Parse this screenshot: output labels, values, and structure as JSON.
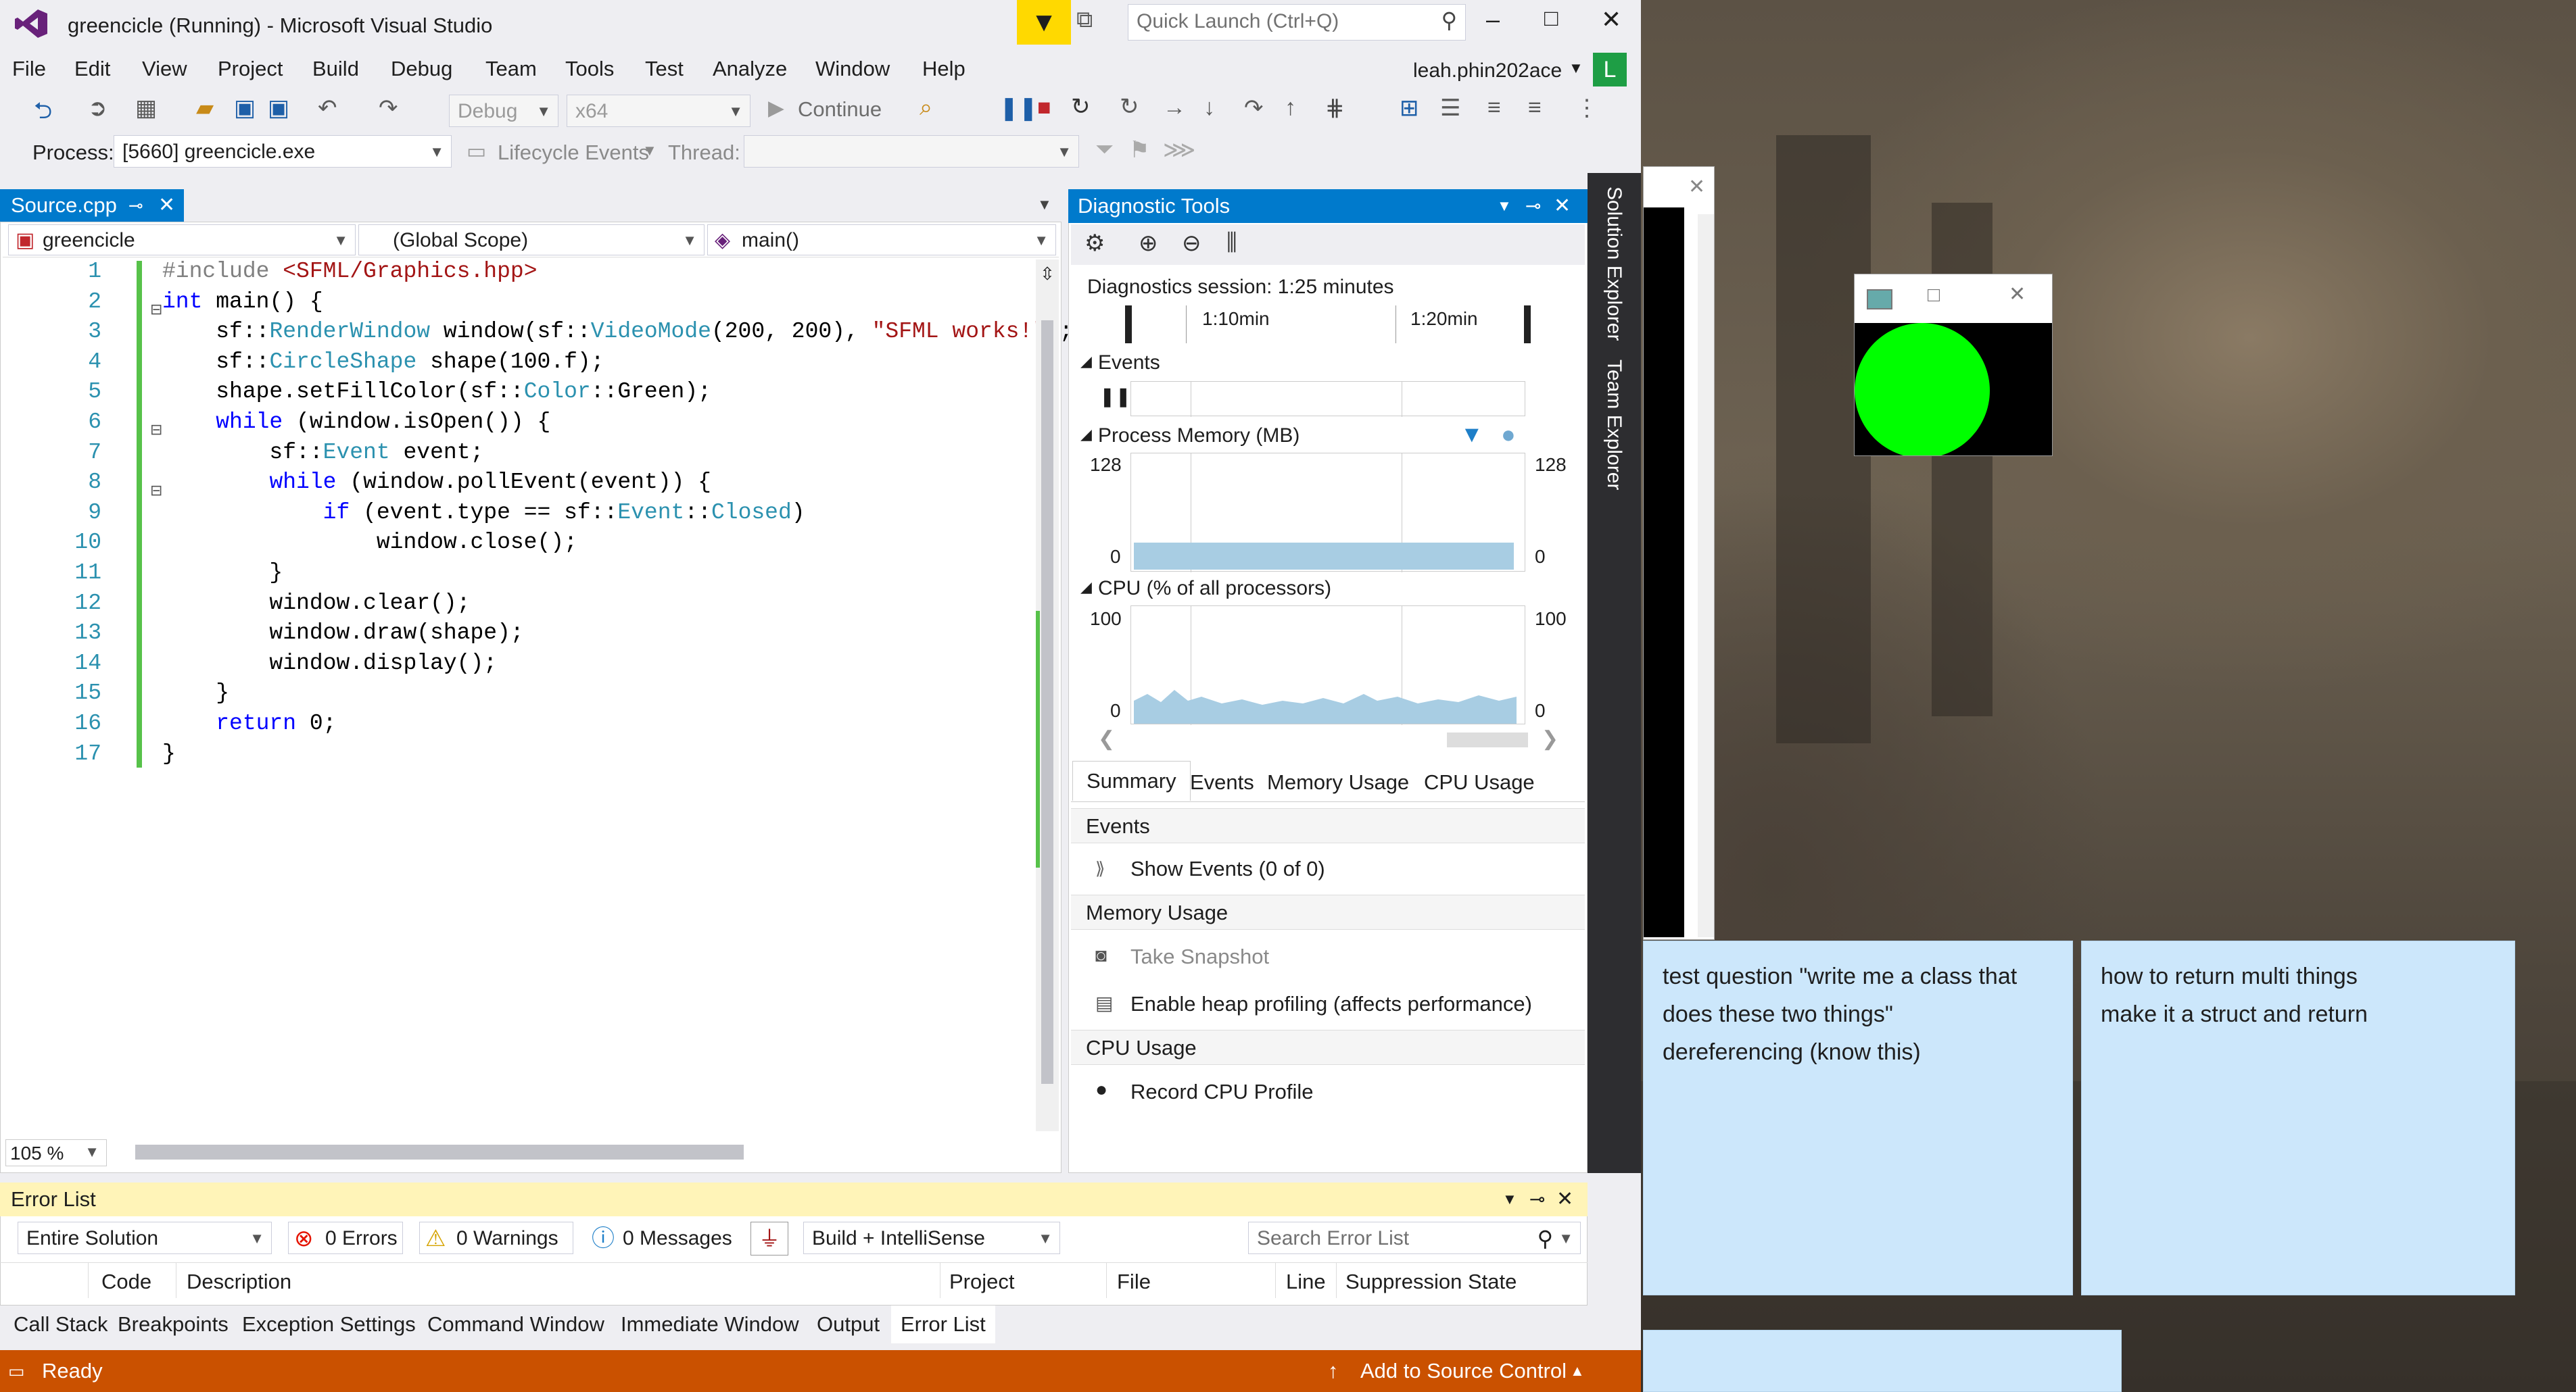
{
  "window": {
    "title": "greencicle (Running) - Microsoft Visual Studio",
    "quick_launch_placeholder": "Quick Launch (Ctrl+Q)",
    "user": "leah.phin202ace",
    "user_initial": "L"
  },
  "menu": [
    "File",
    "Edit",
    "View",
    "Project",
    "Build",
    "Debug",
    "Team",
    "Tools",
    "Test",
    "Analyze",
    "Window",
    "Help"
  ],
  "toolbar": {
    "config": "Debug",
    "platform": "x64",
    "continue_label": "Continue",
    "process_label": "Process:",
    "process_value": "[5660] greencicle.exe",
    "lifecycle_label": "Lifecycle Events",
    "thread_label": "Thread:"
  },
  "editor": {
    "tab": "Source.cpp",
    "project_combo": "greencicle",
    "scope_combo": "(Global Scope)",
    "member_combo": "main()",
    "zoom": "105 %",
    "line_numbers": "1\n2\n3\n4\n5\n6\n7\n8\n9\n10\n11\n12\n13\n14\n15\n16\n17"
  },
  "diagnostics": {
    "title": "Diagnostic Tools",
    "session": "Diagnostics session: 1:25 minutes",
    "tick1": "1:10min",
    "tick2": "1:20min",
    "events_label": "Events",
    "memory_label": "Process Memory (MB)",
    "mem_max": "128",
    "mem_min": "0",
    "cpu_label": "CPU (% of all processors)",
    "cpu_max": "100",
    "cpu_min": "0",
    "tabs": [
      "Summary",
      "Events",
      "Memory Usage",
      "CPU Usage"
    ],
    "sec_events": "Events",
    "show_events": "Show Events (0 of 0)",
    "sec_memory": "Memory Usage",
    "take_snapshot": "Take Snapshot",
    "heap_profiling": "Enable heap profiling (affects performance)",
    "sec_cpu": "CPU Usage",
    "record_cpu": "Record CPU Profile"
  },
  "side_rail": {
    "solution_explorer": "Solution Explorer",
    "team_explorer": "Team Explorer"
  },
  "error_list": {
    "title": "Error List",
    "scope": "Entire Solution",
    "errors": "0 Errors",
    "warnings": "0 Warnings",
    "messages": "0 Messages",
    "build_filter": "Build + IntelliSense",
    "search_placeholder": "Search Error List",
    "columns": [
      "Code",
      "Description",
      "Project",
      "File",
      "Line",
      "Suppression State"
    ]
  },
  "bottom_tabs": [
    "Call Stack",
    "Breakpoints",
    "Exception Settings",
    "Command Window",
    "Immediate Window",
    "Output",
    "Error List"
  ],
  "status": {
    "ready": "Ready",
    "source_control": "Add to Source Control"
  },
  "sticky_notes": [
    {
      "line1": "test question \"write me a class that",
      "line2": "does these two things\"",
      "line3": "dereferencing (know this)"
    },
    {
      "line1": "how to return multi things",
      "line2": "make it a struct and return"
    }
  ],
  "colors": {
    "accent": "#007acc",
    "status": "#ca5100",
    "circle": "#00ff00",
    "sticky": "#cce7fb"
  }
}
